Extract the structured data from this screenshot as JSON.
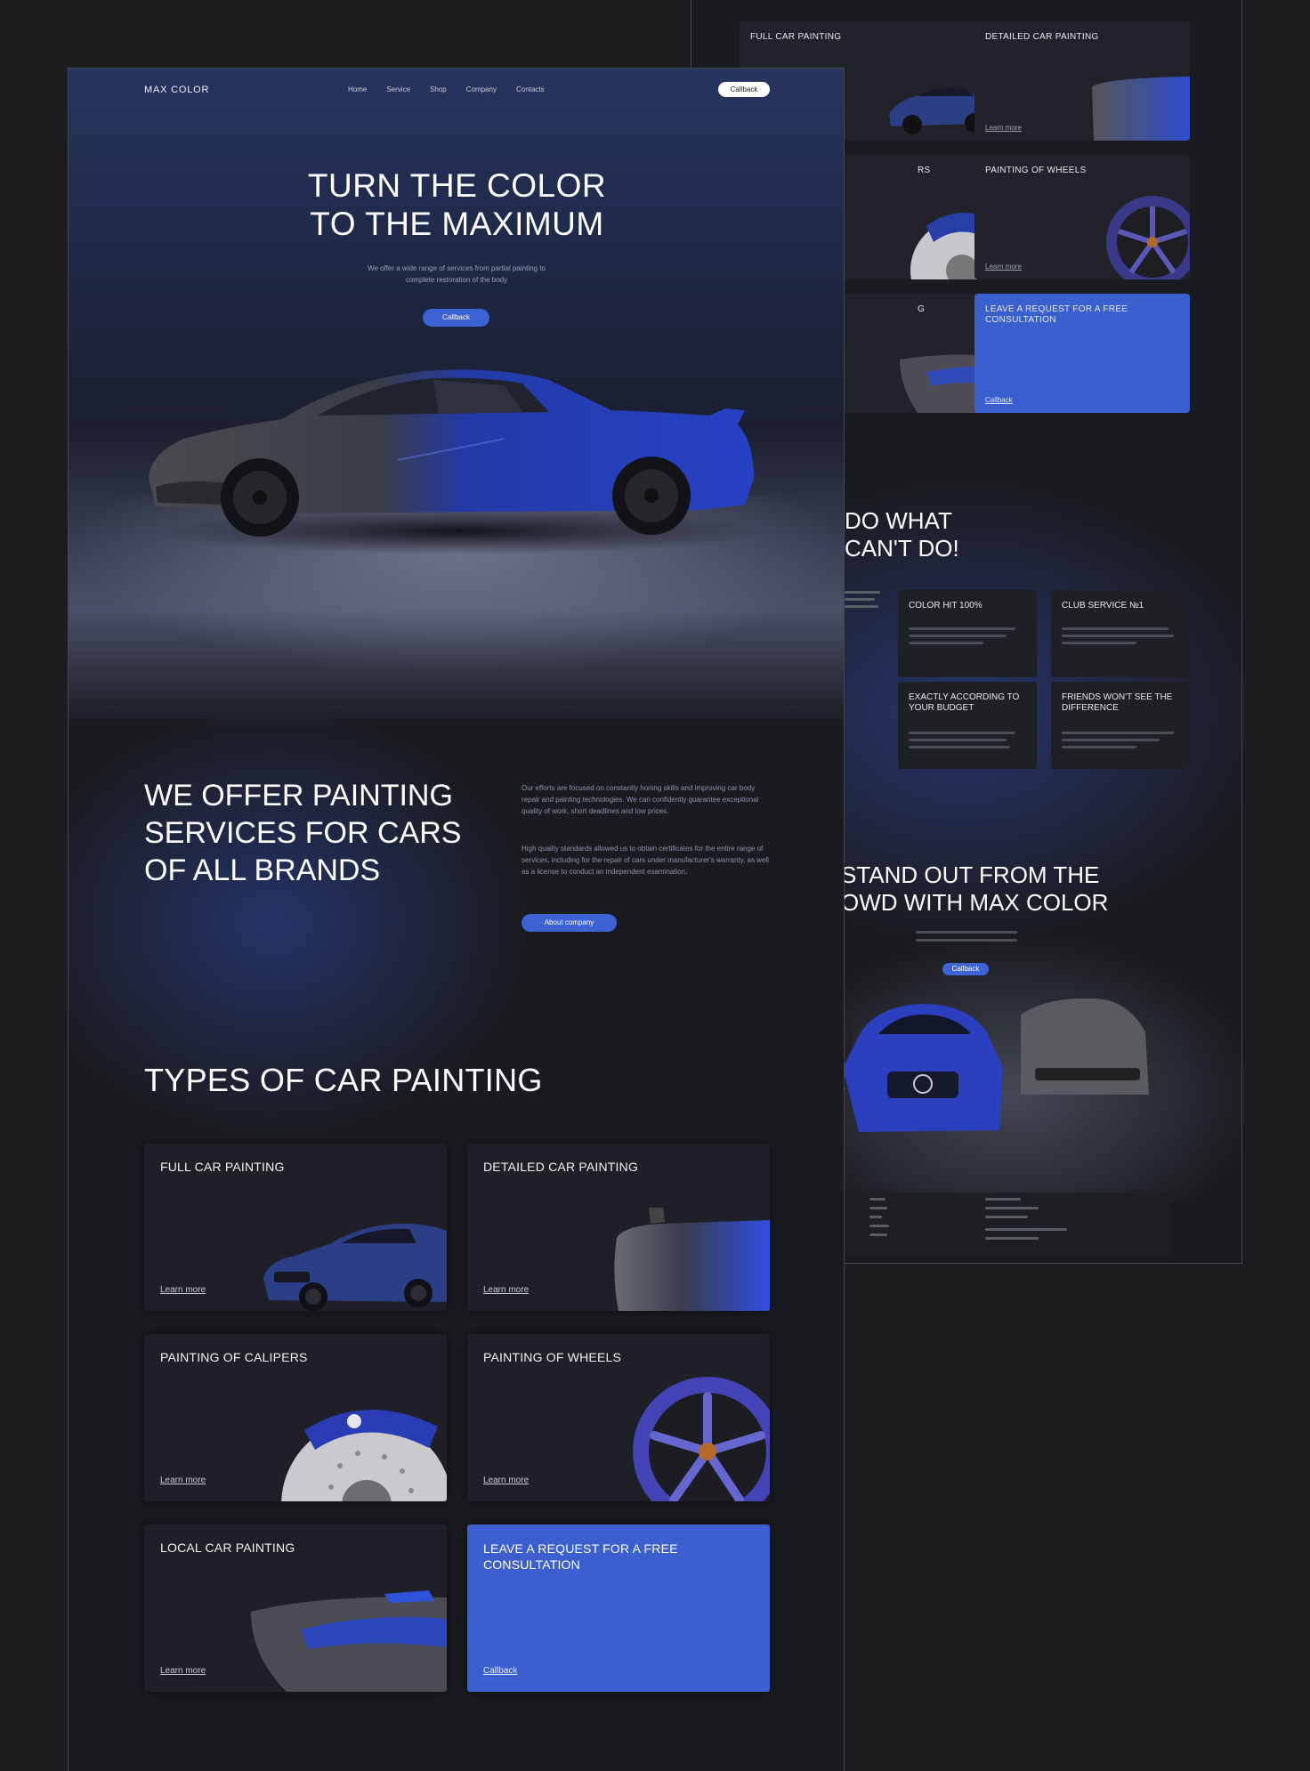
{
  "brand": "MAX COLOR",
  "nav": {
    "links": [
      "Home",
      "Service",
      "Shop",
      "Company",
      "Contacts"
    ],
    "callback": "Callback"
  },
  "hero": {
    "title_line1": "TURN THE COLOR",
    "title_line2": "TO THE MAXIMUM",
    "subtitle": "We offer a wide range of services from partial painting to complete restoration of the body",
    "button": "Callback"
  },
  "offer": {
    "title_line1": "WE OFFER PAINTING",
    "title_line2": "SERVICES FOR CARS",
    "title_line3": "OF ALL BRANDS",
    "text1": "Our efforts are focused on constantly honing skills and improving car body repair and painting technologies. We can confidently guarantee exceptional quality of work, short deadlines and low prices.",
    "text2": "High quality standards allowed us to obtain certificates for the entire range of services, including for the repair of cars under manufacturer's warranty, as well as a license to conduct an independent examination.",
    "button": "About company"
  },
  "types": {
    "title": "TYPES OF CAR PAINTING",
    "cards": [
      {
        "title": "FULL CAR PAINTING",
        "link": "Learn more"
      },
      {
        "title": "DETAILED CAR PAINTING",
        "link": "Learn more"
      },
      {
        "title": "PAINTING OF CALIPERS",
        "link": "Learn more"
      },
      {
        "title": "PAINTING OF WHEELS",
        "link": "Learn more"
      },
      {
        "title": "LOCAL CAR PAINTING",
        "link": "Learn more"
      }
    ],
    "cta": {
      "title": "LEAVE A REQUEST FOR A FREE CONSULTATION",
      "link": "Callback"
    }
  },
  "back_page": {
    "cards": [
      {
        "title": "FULL CAR PAINTING"
      },
      {
        "title": "DETAILED CAR PAINTING",
        "link": "Learn more"
      },
      {
        "title": "RS"
      },
      {
        "title": "PAINTING OF WHEELS",
        "link": "Learn more"
      },
      {
        "title": "G"
      }
    ],
    "cta": {
      "title": "LEAVE A REQUEST FOR A FREE CONSULTATION",
      "link": "Callback"
    },
    "we_do_line1": "DO WHAT",
    "we_do_line2": "CAN'T DO!",
    "features": [
      {
        "title": "COLOR HIT 100%"
      },
      {
        "title": "CLUB SERVICE №1"
      },
      {
        "title": "EXACTLY ACCORDING TO YOUR BUDGET"
      },
      {
        "title": "FRIENDS WON'T SEE THE DIFFERENCE"
      }
    ],
    "stand_line1": "STAND OUT FROM THE",
    "stand_line2": "OWD WITH MAX COLOR",
    "stand_button": "Callback"
  },
  "colors": {
    "accent": "#3c62d3",
    "background": "#1a1b20",
    "card": "#1f2027"
  }
}
